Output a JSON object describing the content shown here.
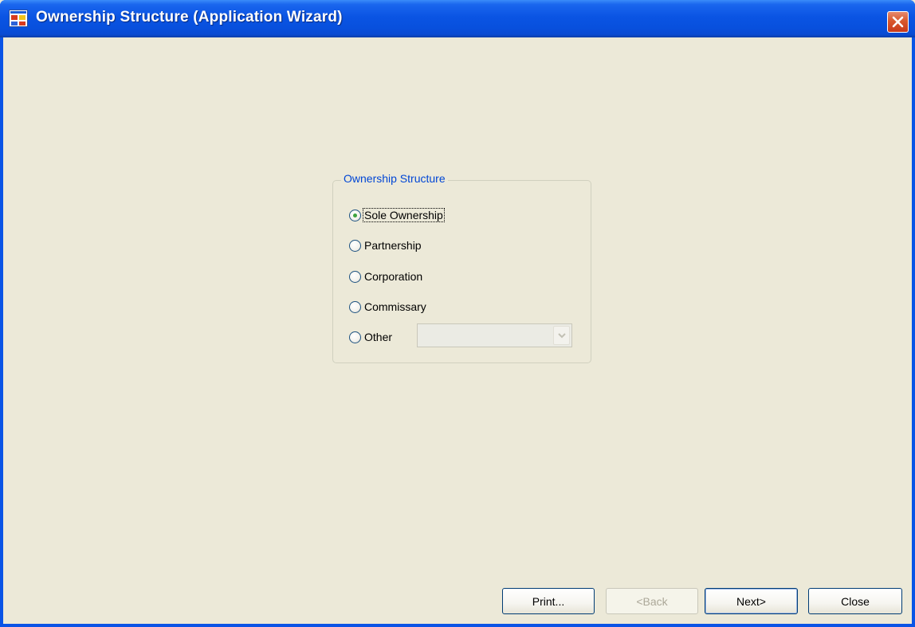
{
  "window": {
    "title": "Ownership Structure (Application Wizard)"
  },
  "group": {
    "legend": "Ownership Structure",
    "options": [
      {
        "label": "Sole Ownership",
        "checked": true
      },
      {
        "label": "Partnership",
        "checked": false
      },
      {
        "label": "Corporation",
        "checked": false
      },
      {
        "label": "Commissary",
        "checked": false
      },
      {
        "label": "Other",
        "checked": false
      }
    ],
    "other_combo_value": ""
  },
  "buttons": {
    "print": "Print...",
    "back": "<Back",
    "next": "Next>",
    "close": "Close"
  },
  "colors": {
    "titlebar": "#0a54e3",
    "window_bg": "#ece9d8",
    "legend_text": "#0046d5",
    "close_button": "#d9582d"
  },
  "icons": [
    "app-icon",
    "close-icon",
    "chevron-down-icon"
  ]
}
